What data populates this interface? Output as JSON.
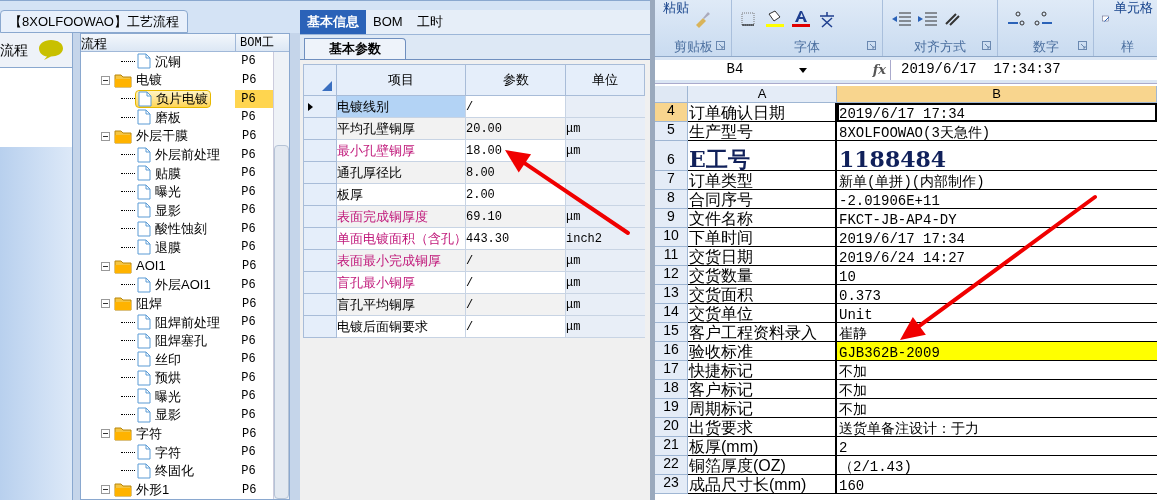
{
  "left_app": {
    "doc_tab": "【8XOLFOOWAO】工艺流程",
    "side_panel": {
      "title": "流程"
    },
    "tree": {
      "columns": [
        "流程",
        "BOM工"
      ],
      "nodes": [
        {
          "children": [
            {
              "label": "沉铜",
              "bom": "P6",
              "selected": false
            }
          ]
        },
        {
          "label": "电镀",
          "bom": "P6",
          "children": [
            {
              "label": "负片电镀",
              "bom": "P6",
              "selected": true
            },
            {
              "label": "磨板",
              "bom": "P6",
              "selected": false
            }
          ]
        },
        {
          "label": "外层干膜",
          "bom": "P6",
          "children": [
            {
              "label": "外层前处理",
              "bom": "P6",
              "selected": false
            },
            {
              "label": "贴膜",
              "bom": "P6",
              "selected": false
            },
            {
              "label": "曝光",
              "bom": "P6",
              "selected": false
            },
            {
              "label": "显影",
              "bom": "P6",
              "selected": false
            },
            {
              "label": "酸性蚀刻",
              "bom": "P6",
              "selected": false
            },
            {
              "label": "退膜",
              "bom": "P6",
              "selected": false
            }
          ]
        },
        {
          "label": "AOI1",
          "bom": "P6",
          "children": [
            {
              "label": "外层AOI1",
              "bom": "P6",
              "selected": false
            }
          ]
        },
        {
          "label": "阻焊",
          "bom": "P6",
          "children": [
            {
              "label": "阻焊前处理",
              "bom": "P6",
              "selected": false
            },
            {
              "label": "阻焊塞孔",
              "bom": "P6",
              "selected": false
            },
            {
              "label": "丝印",
              "bom": "P6",
              "selected": false
            },
            {
              "label": "预烘",
              "bom": "P6",
              "selected": false
            },
            {
              "label": "曝光",
              "bom": "P6",
              "selected": false
            },
            {
              "label": "显影",
              "bom": "P6",
              "selected": false
            }
          ]
        },
        {
          "label": "字符",
          "bom": "P6",
          "children": [
            {
              "label": "字符",
              "bom": "P6",
              "selected": false
            },
            {
              "label": "终固化",
              "bom": "P6",
              "selected": false
            }
          ]
        },
        {
          "label": "外形1",
          "bom": "P6"
        }
      ]
    },
    "detail": {
      "tabs": [
        {
          "label": "基本信息",
          "selected": true
        },
        {
          "label": "BOM",
          "selected": false
        },
        {
          "label": "工时",
          "selected": false
        }
      ],
      "subtabs": [
        {
          "label": "基本参数",
          "selected": true
        }
      ],
      "grid": {
        "columns": [
          "项目",
          "参数",
          "单位"
        ],
        "rows": [
          {
            "item": "电镀线别",
            "value": "/",
            "selected": true,
            "required": false
          },
          {
            "item": "平均孔壁铜厚",
            "value": "20.00",
            "unit": "μm",
            "selected": false,
            "required": false
          },
          {
            "item": "最小孔壁铜厚",
            "value": "18.00",
            "unit": "μm",
            "selected": false,
            "required": true
          },
          {
            "item": "通孔厚径比",
            "value": "8.00",
            "selected": false,
            "required": false
          },
          {
            "item": "板厚",
            "value": "2.00",
            "selected": false,
            "required": false
          },
          {
            "item": "表面完成铜厚度",
            "value": "69.10",
            "unit": "μm",
            "selected": false,
            "required": true
          },
          {
            "item": "单面电镀面积（含孔）",
            "value": "443.30",
            "unit": "inch2",
            "selected": false,
            "required": true
          },
          {
            "item": "表面最小完成铜厚",
            "value": "/",
            "unit": "μm",
            "selected": false,
            "required": true
          },
          {
            "item": "盲孔最小铜厚",
            "value": "/",
            "unit": "μm",
            "selected": false,
            "required": true
          },
          {
            "item": "盲孔平均铜厚",
            "value": "/",
            "unit": "μm",
            "selected": false,
            "required": false
          },
          {
            "item": "电镀后面铜要求",
            "value": "/",
            "unit": "μm",
            "selected": false,
            "required": false
          }
        ]
      }
    }
  },
  "spreadsheet": {
    "paste_label": "粘贴",
    "cell_style_label": "单元格",
    "ribbon_groups": [
      "剪贴板",
      "字体",
      "对齐方式",
      "数字",
      "样"
    ],
    "name_box": "B4",
    "function_label": "fx",
    "formula": "2019/6/17  17:34:37",
    "columns": [
      {
        "label": "A",
        "selected": false
      },
      {
        "label": "B",
        "selected": true
      }
    ],
    "rows": [
      {
        "number": "4",
        "label": "订单确认日期",
        "value": "2019/6/17 17:34",
        "selected": true,
        "highlighted": false,
        "kind": "normal"
      },
      {
        "number": "5",
        "label": "生产型号",
        "value": "8XOLFOOWAO(3天急件)",
        "selected": false,
        "highlighted": false,
        "kind": "normal"
      },
      {
        "number": "6",
        "label": "E工号",
        "value": "1188484",
        "selected": false,
        "highlighted": false,
        "kind": "large"
      },
      {
        "number": "7",
        "label": "订单类型",
        "value": "新单(单拼)(内部制作)",
        "selected": false,
        "highlighted": false,
        "kind": "normal"
      },
      {
        "number": "8",
        "label": "合同序号",
        "value": "-2.01906E+11",
        "selected": false,
        "highlighted": false,
        "kind": "normal"
      },
      {
        "number": "9",
        "label": "文件名称",
        "value": "FKCT-JB-AP4-DY",
        "selected": false,
        "highlighted": false,
        "kind": "normal"
      },
      {
        "number": "10",
        "label": "下单时间",
        "value": "2019/6/17 17:34",
        "selected": false,
        "highlighted": false,
        "kind": "normal"
      },
      {
        "number": "11",
        "label": "交货日期",
        "value": "2019/6/24 14:27",
        "selected": false,
        "highlighted": false,
        "kind": "normal"
      },
      {
        "number": "12",
        "label": "交货数量",
        "value": "10",
        "selected": false,
        "highlighted": false,
        "kind": "normal"
      },
      {
        "number": "13",
        "label": "交货面积",
        "value": "0.373",
        "selected": false,
        "highlighted": false,
        "kind": "normal"
      },
      {
        "number": "14",
        "label": "交货单位",
        "value": "Unit",
        "selected": false,
        "highlighted": false,
        "kind": "normal"
      },
      {
        "number": "15",
        "label": "客户工程资料录入",
        "value": "崔静",
        "selected": false,
        "highlighted": false,
        "kind": "normal"
      },
      {
        "number": "16",
        "label": "验收标准",
        "value": "GJB362B-2009",
        "selected": false,
        "highlighted": true,
        "kind": "normal"
      },
      {
        "number": "17",
        "label": "快捷标记",
        "value": "不加",
        "selected": false,
        "highlighted": false,
        "kind": "normal"
      },
      {
        "number": "18",
        "label": "客户标记",
        "value": "不加",
        "selected": false,
        "highlighted": false,
        "kind": "normal"
      },
      {
        "number": "19",
        "label": "周期标记",
        "value": "不加",
        "selected": false,
        "highlighted": false,
        "kind": "normal"
      },
      {
        "number": "20",
        "label": "出货要求",
        "value": "送货单备注设计：于力",
        "selected": false,
        "highlighted": false,
        "kind": "normal"
      },
      {
        "number": "21",
        "label": "板厚(mm)",
        "value": "2",
        "selected": false,
        "highlighted": false,
        "kind": "normal"
      },
      {
        "number": "22",
        "label": "铜箔厚度(OZ)",
        "value": "（2/1.43)",
        "selected": false,
        "highlighted": false,
        "kind": "normal"
      },
      {
        "number": "23",
        "label": "成品尺寸长(mm)",
        "value": "160",
        "selected": false,
        "highlighted": false,
        "kind": "normal"
      }
    ]
  },
  "annotations": [
    {
      "kind": "arrow"
    },
    {
      "kind": "arrow"
    }
  ]
}
